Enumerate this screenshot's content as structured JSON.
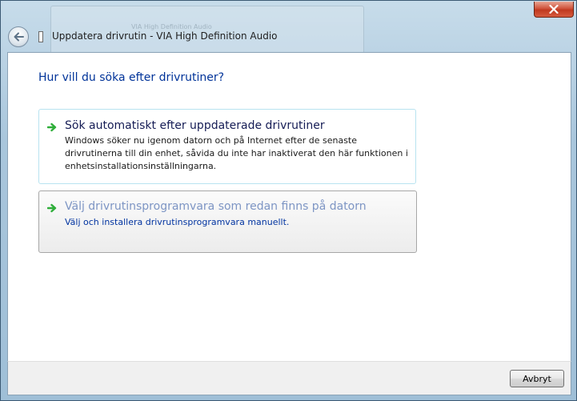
{
  "window": {
    "title": "Uppdatera drivrutin - VIA High Definition Audio",
    "background_text": "VIA High Definition Audio"
  },
  "titlebar": {
    "back_icon": "back-arrow-icon",
    "close_icon": "close-icon"
  },
  "main": {
    "heading": "Hur vill du söka efter drivrutiner?",
    "options": [
      {
        "title": "Sök automatiskt efter uppdaterade drivrutiner",
        "description": "Windows söker nu igenom datorn och på Internet efter de senaste drivrutinerna till din enhet, såvida du inte har inaktiverat den här funktionen i enhetsinstallationsinställningarna.",
        "icon": "green-arrow-icon"
      },
      {
        "title": "Välj drivrutinsprogramvara som redan finns på datorn",
        "description": "Välj och installera drivrutinsprogramvara manuellt.",
        "icon": "green-arrow-icon"
      }
    ]
  },
  "footer": {
    "cancel_label": "Avbryt"
  },
  "colors": {
    "heading": "#003399",
    "option_hover_border": "#b8e3f0",
    "accent_green": "#2fae3a",
    "close_red": "#c0391f"
  }
}
